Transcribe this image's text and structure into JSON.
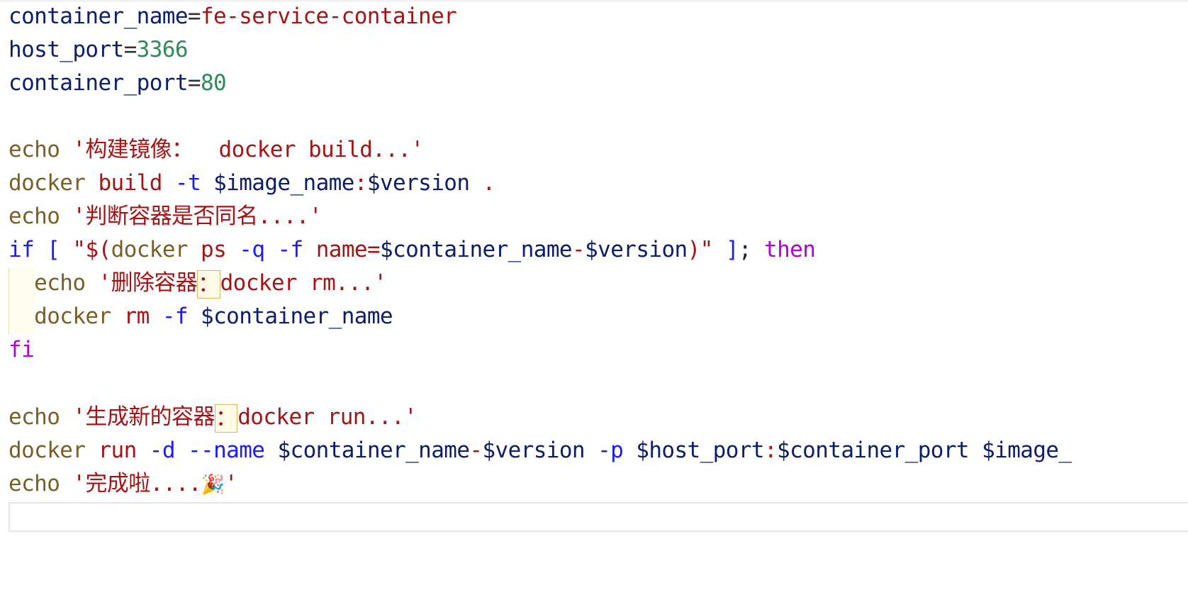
{
  "editor": {
    "lines": [
      {
        "id": "l1",
        "tokens": [
          {
            "t": "container_name",
            "c": "var"
          },
          {
            "t": "=",
            "c": "op"
          },
          {
            "t": "fe-service-container",
            "c": "str"
          }
        ]
      },
      {
        "id": "l2",
        "tokens": [
          {
            "t": "host_port",
            "c": "var"
          },
          {
            "t": "=",
            "c": "op"
          },
          {
            "t": "3366",
            "c": "num"
          }
        ]
      },
      {
        "id": "l3",
        "tokens": [
          {
            "t": "container_port",
            "c": "var"
          },
          {
            "t": "=",
            "c": "op"
          },
          {
            "t": "80",
            "c": "num"
          }
        ]
      },
      {
        "id": "l4",
        "tokens": []
      },
      {
        "id": "l5",
        "tokens": [
          {
            "t": "echo",
            "c": "cmd"
          },
          {
            "t": " ",
            "c": "plain"
          },
          {
            "t": "'构建镜像：  docker build...'",
            "c": "str"
          }
        ]
      },
      {
        "id": "l6",
        "tokens": [
          {
            "t": "docker",
            "c": "cmd"
          },
          {
            "t": " ",
            "c": "plain"
          },
          {
            "t": "build",
            "c": "red"
          },
          {
            "t": " ",
            "c": "plain"
          },
          {
            "t": "-t",
            "c": "blue"
          },
          {
            "t": " ",
            "c": "plain"
          },
          {
            "t": "$image_name",
            "c": "var"
          },
          {
            "t": ":",
            "c": "red"
          },
          {
            "t": "$version",
            "c": "var"
          },
          {
            "t": " ",
            "c": "plain"
          },
          {
            "t": ".",
            "c": "red"
          }
        ]
      },
      {
        "id": "l7",
        "tokens": [
          {
            "t": "echo",
            "c": "cmd"
          },
          {
            "t": " ",
            "c": "plain"
          },
          {
            "t": "'判断容器是否同名....'",
            "c": "str"
          }
        ]
      },
      {
        "id": "l8",
        "tokens": [
          {
            "t": "if",
            "c": "blue"
          },
          {
            "t": " ",
            "c": "plain"
          },
          {
            "t": "[",
            "c": "blue"
          },
          {
            "t": " ",
            "c": "plain"
          },
          {
            "t": "\"$(",
            "c": "red"
          },
          {
            "t": "docker",
            "c": "cmd"
          },
          {
            "t": " ",
            "c": "plain"
          },
          {
            "t": "ps",
            "c": "red"
          },
          {
            "t": " ",
            "c": "plain"
          },
          {
            "t": "-q",
            "c": "blue"
          },
          {
            "t": " ",
            "c": "plain"
          },
          {
            "t": "-f",
            "c": "blue"
          },
          {
            "t": " ",
            "c": "plain"
          },
          {
            "t": "name=",
            "c": "red"
          },
          {
            "t": "$container_name",
            "c": "var"
          },
          {
            "t": "-",
            "c": "red"
          },
          {
            "t": "$version",
            "c": "var"
          },
          {
            "t": ")\"",
            "c": "red"
          },
          {
            "t": " ",
            "c": "plain"
          },
          {
            "t": "]",
            "c": "blue"
          },
          {
            "t": "; ",
            "c": "plain"
          },
          {
            "t": "then",
            "c": "kw"
          }
        ]
      },
      {
        "id": "l9",
        "tokens": [
          {
            "t": "  ",
            "c": "plain"
          },
          {
            "t": "echo",
            "c": "cmd"
          },
          {
            "t": " ",
            "c": "plain"
          },
          {
            "t": "'删除容器",
            "c": "str"
          },
          {
            "t": "：",
            "c": "box"
          },
          {
            "t": "docker rm...'",
            "c": "str"
          }
        ]
      },
      {
        "id": "l10",
        "tokens": [
          {
            "t": "  ",
            "c": "plain"
          },
          {
            "t": "docker",
            "c": "cmd"
          },
          {
            "t": " ",
            "c": "plain"
          },
          {
            "t": "rm",
            "c": "red"
          },
          {
            "t": " ",
            "c": "plain"
          },
          {
            "t": "-f",
            "c": "blue"
          },
          {
            "t": " ",
            "c": "plain"
          },
          {
            "t": "$container_name",
            "c": "var"
          }
        ]
      },
      {
        "id": "l11",
        "tokens": [
          {
            "t": "fi",
            "c": "kw"
          }
        ]
      },
      {
        "id": "l12",
        "tokens": []
      },
      {
        "id": "l13",
        "tokens": [
          {
            "t": "echo",
            "c": "cmd"
          },
          {
            "t": " ",
            "c": "plain"
          },
          {
            "t": "'生成新的容器",
            "c": "str"
          },
          {
            "t": "：",
            "c": "box"
          },
          {
            "t": "docker run...'",
            "c": "str"
          }
        ]
      },
      {
        "id": "l14",
        "tokens": [
          {
            "t": "docker",
            "c": "cmd"
          },
          {
            "t": " ",
            "c": "plain"
          },
          {
            "t": "run",
            "c": "red"
          },
          {
            "t": " ",
            "c": "plain"
          },
          {
            "t": "-d",
            "c": "blue"
          },
          {
            "t": " ",
            "c": "plain"
          },
          {
            "t": "--name",
            "c": "blue"
          },
          {
            "t": " ",
            "c": "plain"
          },
          {
            "t": "$container_name",
            "c": "var"
          },
          {
            "t": "-",
            "c": "red"
          },
          {
            "t": "$version",
            "c": "var"
          },
          {
            "t": " ",
            "c": "plain"
          },
          {
            "t": "-p",
            "c": "blue"
          },
          {
            "t": " ",
            "c": "plain"
          },
          {
            "t": "$host_port",
            "c": "var"
          },
          {
            "t": ":",
            "c": "red"
          },
          {
            "t": "$container_port",
            "c": "var"
          },
          {
            "t": " ",
            "c": "plain"
          },
          {
            "t": "$image_",
            "c": "var"
          }
        ]
      },
      {
        "id": "l15",
        "tokens": [
          {
            "t": "echo",
            "c": "cmd"
          },
          {
            "t": " ",
            "c": "plain"
          },
          {
            "t": "'完成啦....",
            "c": "str"
          },
          {
            "t": "🎉",
            "c": "party"
          },
          {
            "t": "'",
            "c": "str"
          }
        ]
      }
    ]
  }
}
